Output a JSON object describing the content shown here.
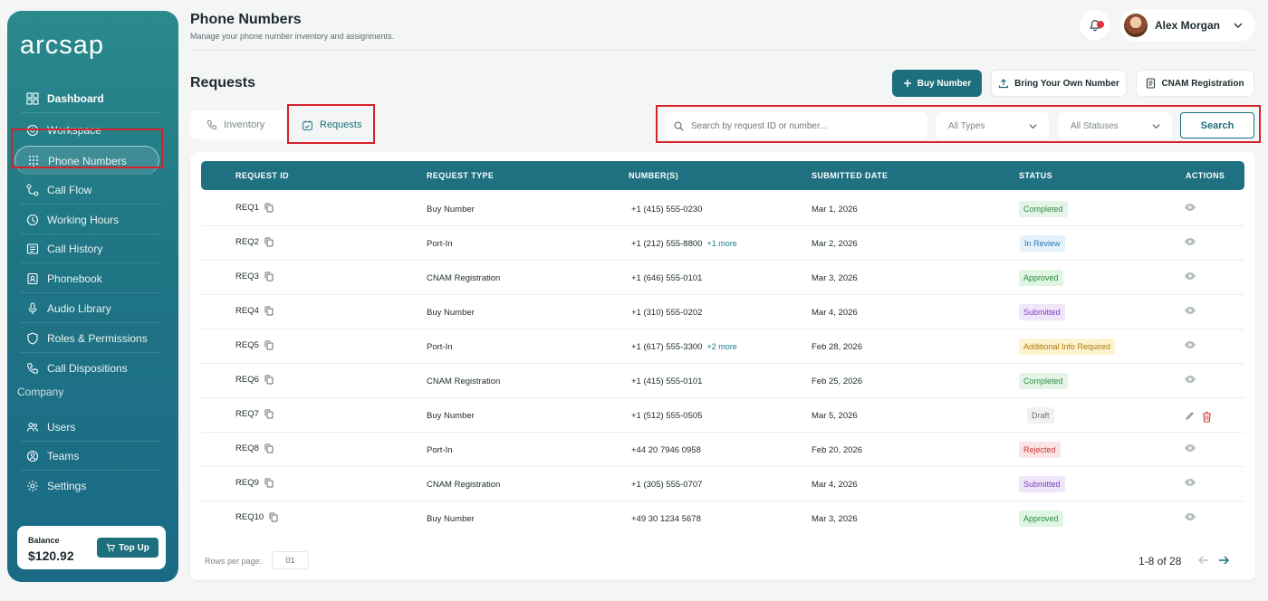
{
  "app": {
    "logo": "arcsap"
  },
  "sidebar": {
    "items": [
      {
        "label": "Dashboard",
        "icon": "grid-icon"
      },
      {
        "label": "Workspace",
        "icon": "workspace-icon"
      },
      {
        "label": "Phone Numbers",
        "icon": "dialpad-icon"
      },
      {
        "label": "Call Flow",
        "icon": "flow-icon"
      },
      {
        "label": "Working Hours",
        "icon": "clock-icon"
      },
      {
        "label": "Call History",
        "icon": "history-icon"
      },
      {
        "label": "Phonebook",
        "icon": "contacts-icon"
      },
      {
        "label": "Audio Library",
        "icon": "mic-icon"
      },
      {
        "label": "Roles & Permissions",
        "icon": "shield-icon"
      },
      {
        "label": "Call Dispositions",
        "icon": "phone-icon"
      }
    ],
    "company_label": "Company",
    "company_items": [
      {
        "label": "Users",
        "icon": "users-icon"
      },
      {
        "label": "Teams",
        "icon": "teams-icon"
      },
      {
        "label": "Settings",
        "icon": "gear-icon"
      }
    ],
    "balance": {
      "label": "Balance",
      "value": "$120.92",
      "topup_label": "Top Up"
    }
  },
  "header": {
    "title": "Phone Numbers",
    "subtitle": "Manage your phone number inventory and assignments.",
    "user_name": "Alex Morgan"
  },
  "main": {
    "section_title": "Requests",
    "actions": {
      "buy": "Buy Number",
      "byon": "Bring Your Own Number",
      "cnam": "CNAM Registration"
    },
    "tabs": [
      {
        "label": "Inventory"
      },
      {
        "label": "Requests"
      }
    ],
    "filters": {
      "search_placeholder": "Search by request ID or number...",
      "types": "All Types",
      "statuses": "All Statuses",
      "search_button": "Search"
    },
    "table": {
      "columns": [
        "REQUEST ID",
        "REQUEST TYPE",
        "NUMBER(S)",
        "SUBMITTED DATE",
        "STATUS",
        "ACTIONS"
      ],
      "rows": [
        {
          "id": "REQ1",
          "type": "Buy Number",
          "number": "+1 (415) 555-0230",
          "more": "",
          "date": "Mar 1, 2026",
          "status": "Completed"
        },
        {
          "id": "REQ2",
          "type": "Port-In",
          "number": "+1 (212) 555-8800",
          "more": "+1 more",
          "date": "Mar 2, 2026",
          "status": "In Review"
        },
        {
          "id": "REQ3",
          "type": "CNAM Registration",
          "number": "+1 (646) 555-0101",
          "more": "",
          "date": "Mar 3, 2026",
          "status": "Approved"
        },
        {
          "id": "REQ4",
          "type": "Buy Number",
          "number": "+1 (310) 555-0202",
          "more": "",
          "date": "Mar 4, 2026",
          "status": "Submitted"
        },
        {
          "id": "REQ5",
          "type": "Port-In",
          "number": "+1 (617) 555-3300",
          "more": "+2 more",
          "date": "Feb 28, 2026",
          "status": "Additional Info Required"
        },
        {
          "id": "REQ6",
          "type": "CNAM Registration",
          "number": "+1 (415) 555-0101",
          "more": "",
          "date": "Feb 25, 2026",
          "status": "Completed"
        },
        {
          "id": "REQ7",
          "type": "Buy Number",
          "number": "+1 (512) 555-0505",
          "more": "",
          "date": "Mar 5, 2026",
          "status": "Draft"
        },
        {
          "id": "REQ8",
          "type": "Port-In",
          "number": "+44 20 7946 0958",
          "more": "",
          "date": "Feb 20, 2026",
          "status": "Rejected"
        },
        {
          "id": "REQ9",
          "type": "CNAM Registration",
          "number": "+1 (305) 555-0707",
          "more": "",
          "date": "Mar 4, 2026",
          "status": "Submitted"
        },
        {
          "id": "REQ10",
          "type": "Buy Number",
          "number": "+49 30 1234 5678",
          "more": "",
          "date": "Mar 3, 2026",
          "status": "Approved"
        }
      ]
    },
    "footer": {
      "rows_label": "Rows per page:",
      "rows_value": "01",
      "range": "1-8 of 28"
    }
  }
}
